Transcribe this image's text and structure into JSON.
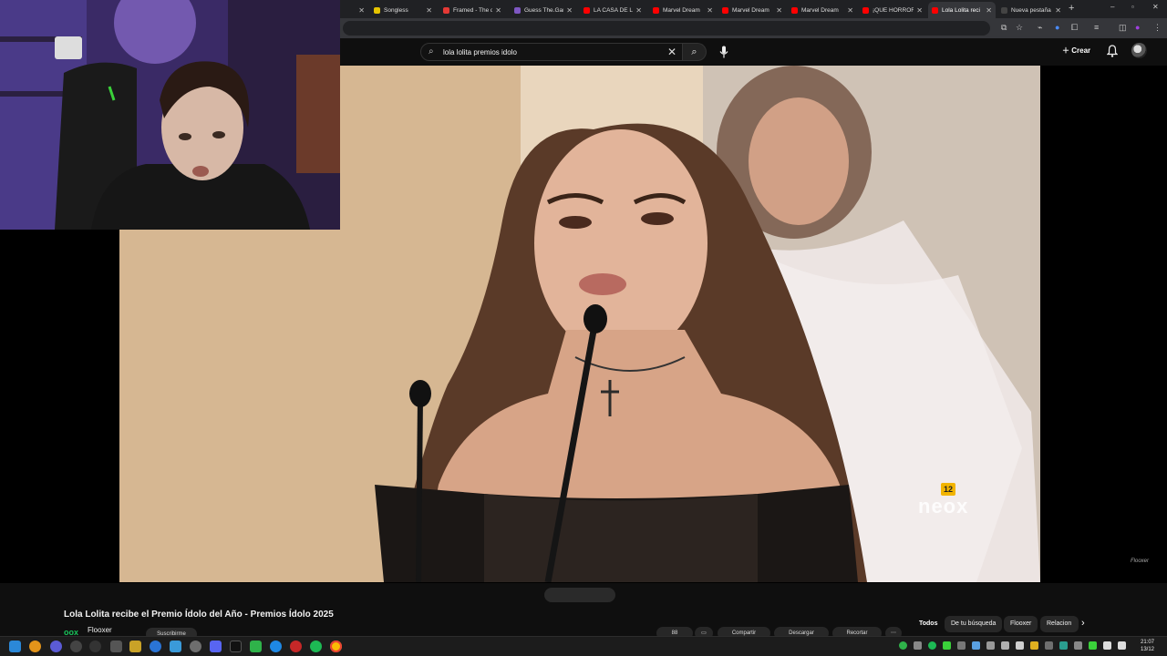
{
  "browser": {
    "tabs": [
      {
        "title": "r",
        "favicon_color": "#ff0000",
        "active": false
      },
      {
        "title": "Songless",
        "favicon_color": "#e6c400",
        "active": false
      },
      {
        "title": "Framed - The d",
        "favicon_color": "#e53935",
        "active": false
      },
      {
        "title": "Guess The.Gam",
        "favicon_color": "#7e57c2",
        "active": false
      },
      {
        "title": "LA CASA DE LO",
        "favicon_color": "#ff0000",
        "active": false
      },
      {
        "title": "Marvel Dream",
        "favicon_color": "#ff0000",
        "active": false
      },
      {
        "title": "Marvel Dream",
        "favicon_color": "#ff0000",
        "active": false
      },
      {
        "title": "Marvel Dream",
        "favicon_color": "#ff0000",
        "active": false
      },
      {
        "title": "¡QUE HORROR",
        "favicon_color": "#ff0000",
        "active": false
      },
      {
        "title": "Lola Lolita reci",
        "favicon_color": "#ff0000",
        "active": true
      },
      {
        "title": "Nueva pestaña",
        "favicon_color": "#444444",
        "active": false
      }
    ],
    "new_tab_symbol": "+",
    "window_controls": [
      "–",
      "▫",
      "✕"
    ]
  },
  "youtube": {
    "search": {
      "query": "lola lolita premios idolo",
      "clear_symbol": "✕",
      "search_symbol": "⌕"
    },
    "create_label": "Crear",
    "video": {
      "watermark": "Flooxer",
      "channel_bug_number": "12",
      "channel_bug_text": "neox"
    },
    "title": "Lola Lolita recibe el Premio Ídolo del Año - Premios Ídolo 2025",
    "channel": {
      "name": "Flooxer",
      "logo_text": "oox"
    },
    "subscribe_label": "Suscribirme",
    "actions": [
      "88",
      "Compartir",
      "Descargar",
      "Recortar"
    ],
    "chips": [
      "Todos",
      "De tu búsqueda",
      "Flooxer",
      "Relacion"
    ],
    "chip_next_symbol": "›"
  },
  "taskbar": {
    "time": "21:07",
    "date": "13/12"
  }
}
